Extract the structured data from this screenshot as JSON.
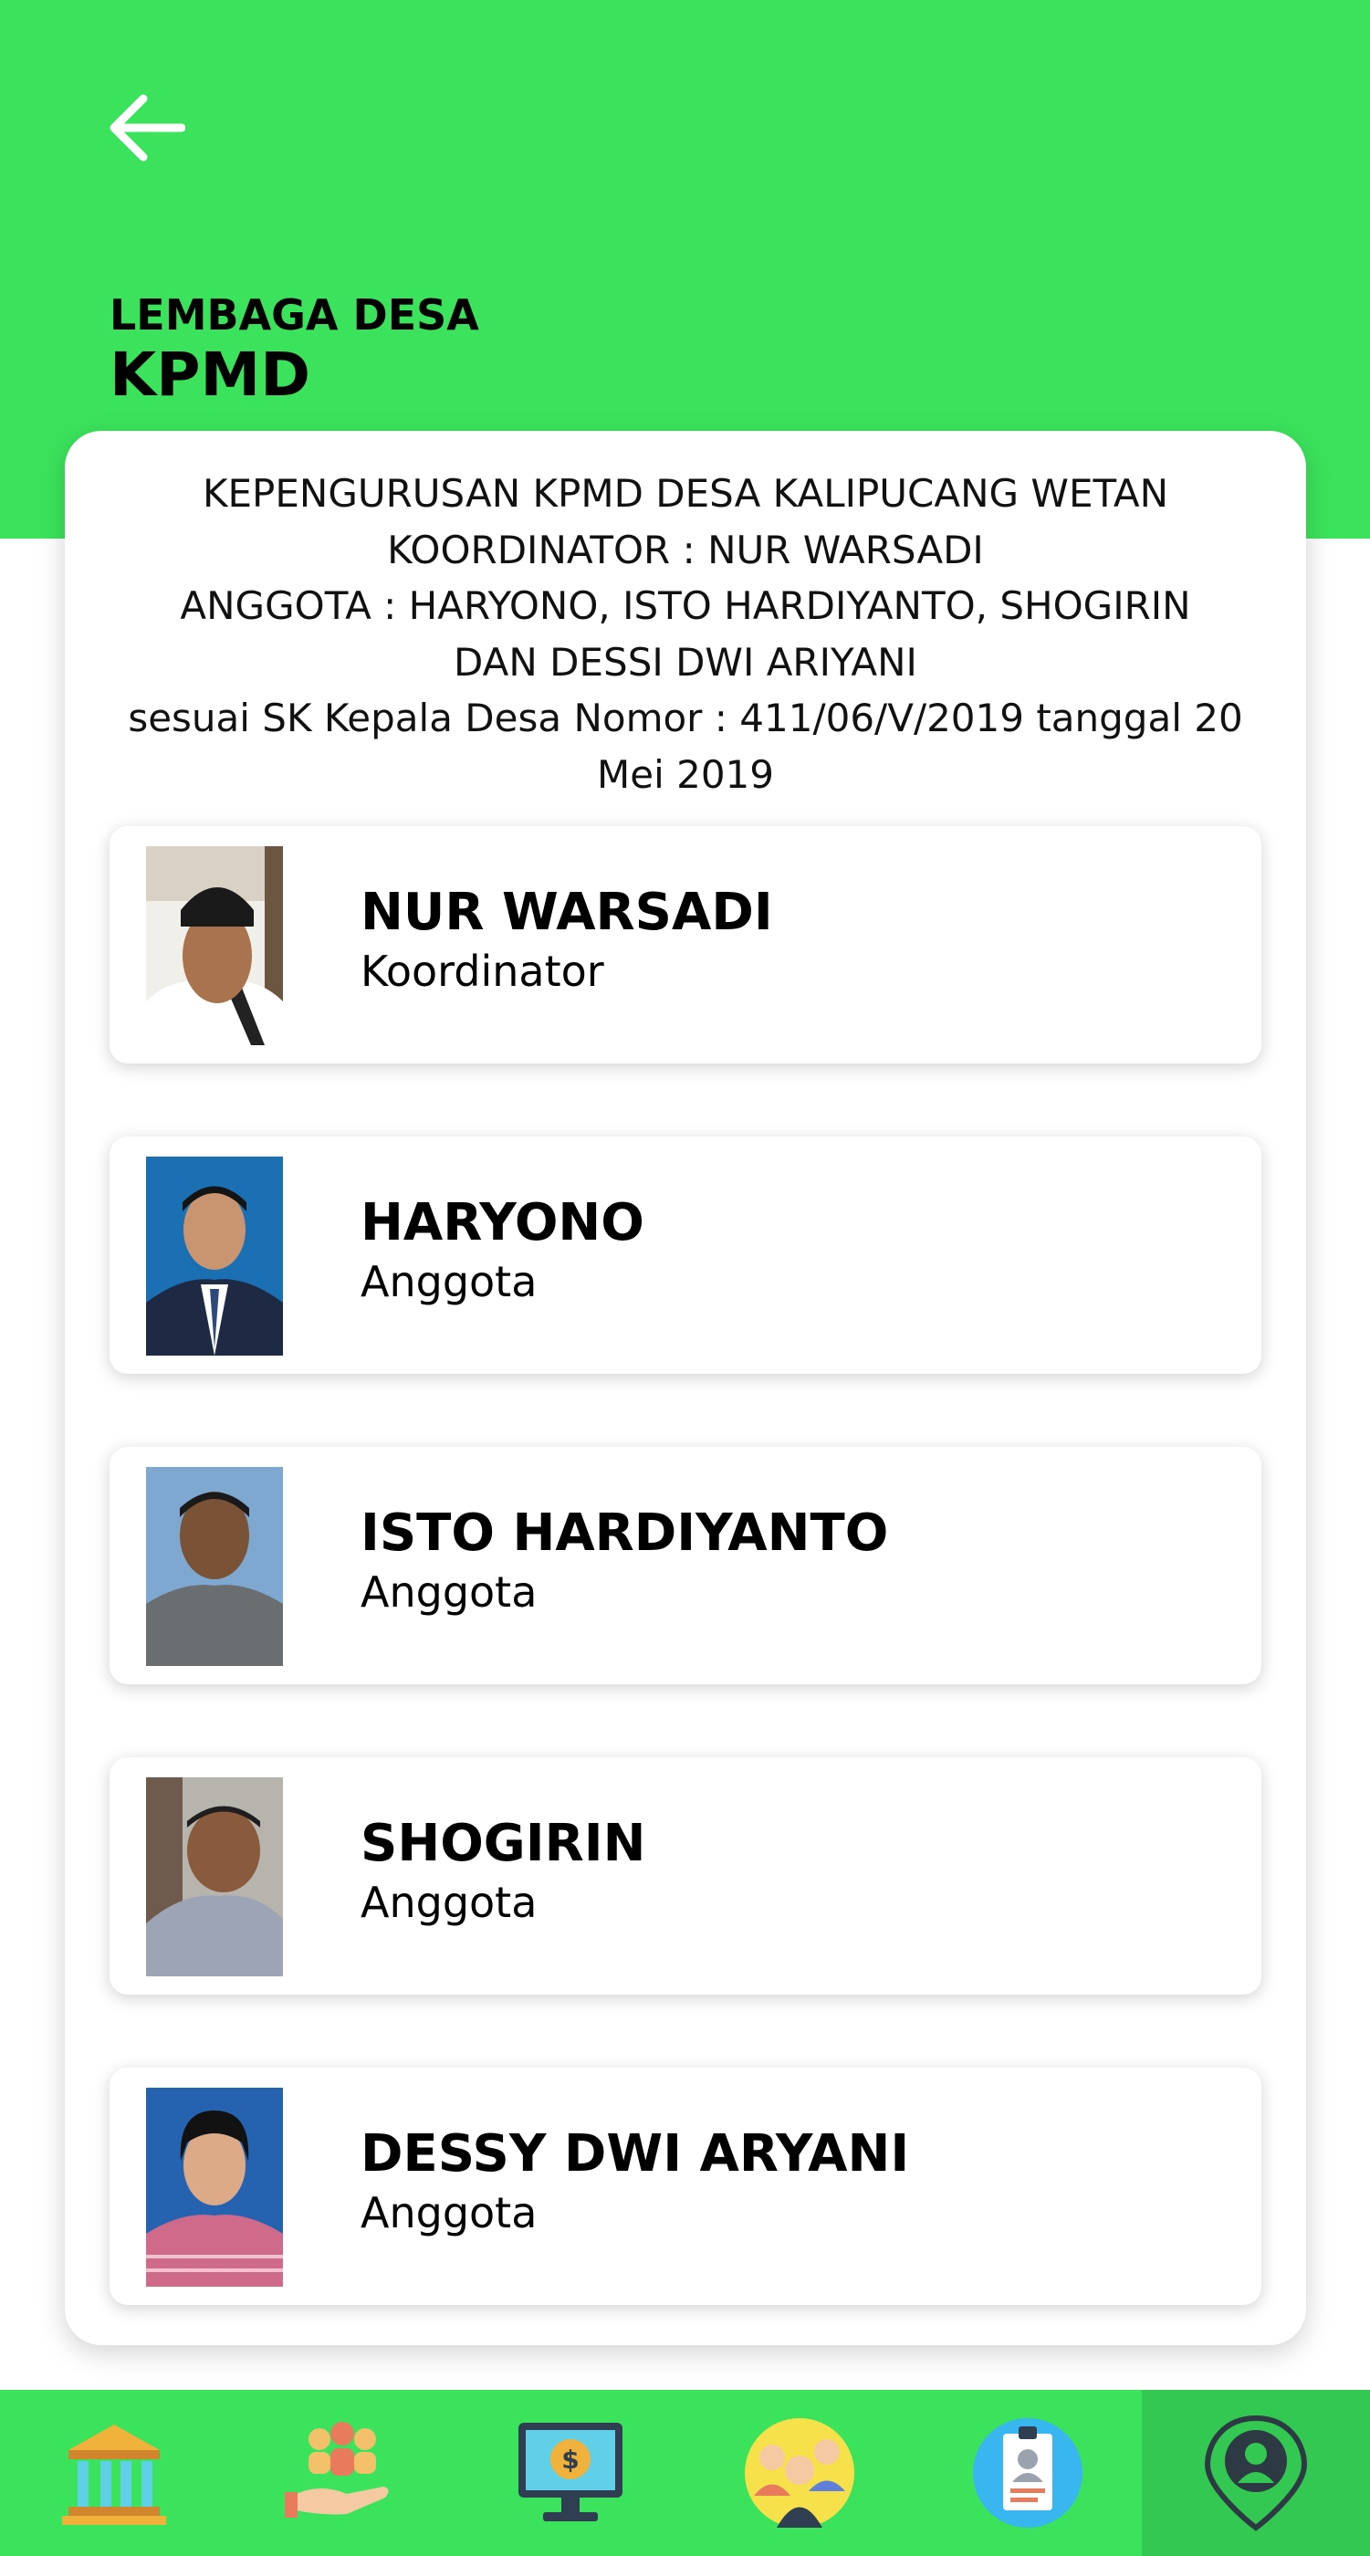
{
  "header": {
    "subtitle": "LEMBAGA DESA",
    "title": "KPMD",
    "color": "#3be35c"
  },
  "description": {
    "line1": "KEPENGURUSAN KPMD DESA KALIPUCANG WETAN",
    "line2": "KOORDINATOR : NUR WARSADI",
    "line3": "ANGGOTA : HARYONO, ISTO HARDIYANTO, SHOGIRIN DAN DESSI DWI ARIYANI",
    "line4": "sesuai SK Kepala Desa Nomor : 411/06/V/2019 tanggal 20 Mei 2019"
  },
  "members": [
    {
      "name": "NUR WARSADI",
      "role": "Koordinator",
      "photo_bg": "white"
    },
    {
      "name": "HARYONO",
      "role": "Anggota",
      "photo_bg": "blue"
    },
    {
      "name": "ISTO HARDIYANTO",
      "role": "Anggota",
      "photo_bg": "light-blue"
    },
    {
      "name": "SHOGIRIN",
      "role": "Anggota",
      "photo_bg": "grey"
    },
    {
      "name": "DESSY DWI ARYANI",
      "role": "Anggota",
      "photo_bg": "blue"
    }
  ],
  "nav": [
    {
      "icon": "bank-building-icon"
    },
    {
      "icon": "community-hand-icon"
    },
    {
      "icon": "monitor-dollar-icon"
    },
    {
      "icon": "people-group-icon"
    },
    {
      "icon": "id-badge-icon"
    },
    {
      "icon": "location-person-icon",
      "active": true
    }
  ]
}
